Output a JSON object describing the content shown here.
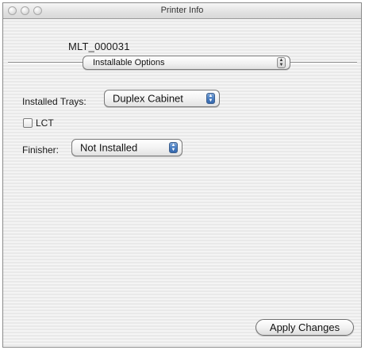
{
  "window": {
    "title": "Printer Info"
  },
  "printer": {
    "name": "MLT_000031"
  },
  "options_menu": {
    "selected": "Installable Options"
  },
  "installed_trays": {
    "label": "Installed Trays:",
    "value": "Duplex Cabinet"
  },
  "lct": {
    "label": "LCT",
    "checked": false
  },
  "finisher": {
    "label": "Finisher:",
    "value": "Not Installed"
  },
  "apply_button": {
    "label": "Apply Changes"
  },
  "icons": {
    "window_close": "close-icon",
    "window_minimize": "minimize-icon",
    "window_zoom": "zoom-icon",
    "popup_arrows": "updown-arrows-icon",
    "checkbox": "checkbox-icon"
  }
}
